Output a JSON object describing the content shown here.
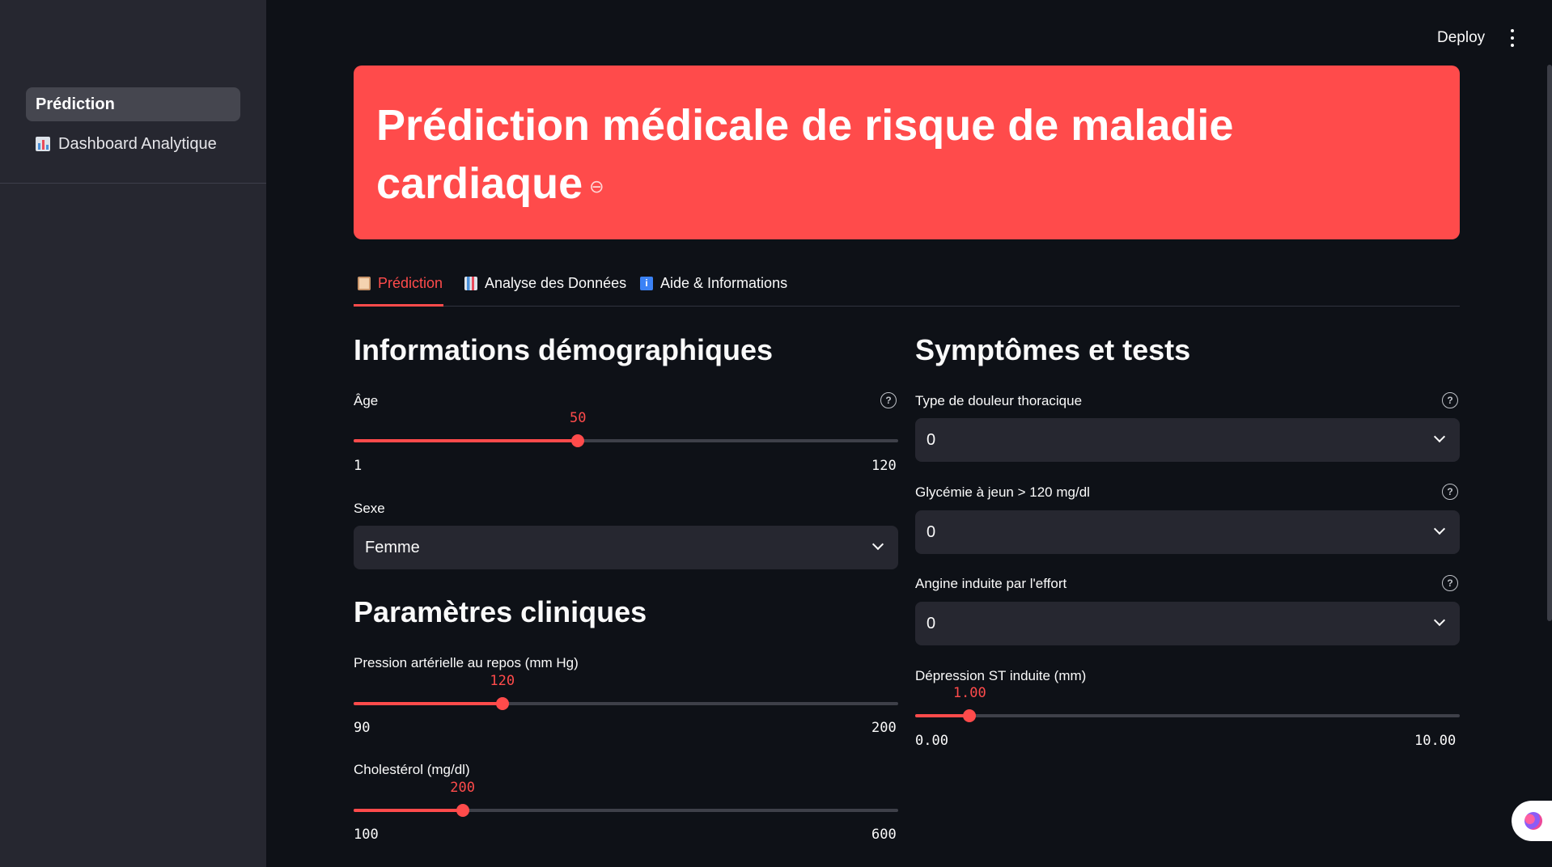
{
  "sidebar": {
    "items": [
      {
        "label": "Prédiction",
        "active": true
      },
      {
        "label": "Dashboard Analytique",
        "icon": "bar-chart-icon"
      }
    ]
  },
  "topbar": {
    "deploy_label": "Deploy",
    "menu_icon": "kebab-menu-icon"
  },
  "banner": {
    "title": "Prédiction médicale de risque de maladie cardiaque",
    "link_icon": "link-icon",
    "color": "#ff4b4b"
  },
  "tabs": [
    {
      "label": "Prédiction",
      "icon": "clipboard-icon",
      "active": true
    },
    {
      "label": "Analyse des Données",
      "icon": "bar-chart-icon",
      "active": false
    },
    {
      "label": "Aide & Informations",
      "icon": "info-icon",
      "active": false
    }
  ],
  "left": {
    "demo_heading": "Informations démographiques",
    "age": {
      "label": "Âge",
      "value": "50",
      "min": "1",
      "max": "120",
      "fraction": 0.412
    },
    "sexe": {
      "label": "Sexe",
      "value": "Femme"
    },
    "clinical_heading": "Paramètres cliniques",
    "bp": {
      "label": "Pression artérielle au repos (mm Hg)",
      "value": "120",
      "min": "90",
      "max": "200",
      "fraction": 0.273
    },
    "chol": {
      "label": "Cholestérol (mg/dl)",
      "value": "200",
      "min": "100",
      "max": "600",
      "fraction": 0.2
    }
  },
  "right": {
    "heading": "Symptômes et tests",
    "chest_pain": {
      "label": "Type de douleur thoracique",
      "value": "0"
    },
    "glycemia": {
      "label": "Glycémie à jeun > 120 mg/dl",
      "value": "0"
    },
    "angina": {
      "label": "Angine induite par l'effort",
      "value": "0"
    },
    "st_depression": {
      "label": "Dépression ST induite (mm)",
      "value": "1.00",
      "min": "0.00",
      "max": "10.00",
      "fraction": 0.1
    }
  },
  "colors": {
    "accent": "#ff4b4b",
    "background": "#0e1117",
    "sidebar": "#262730"
  }
}
